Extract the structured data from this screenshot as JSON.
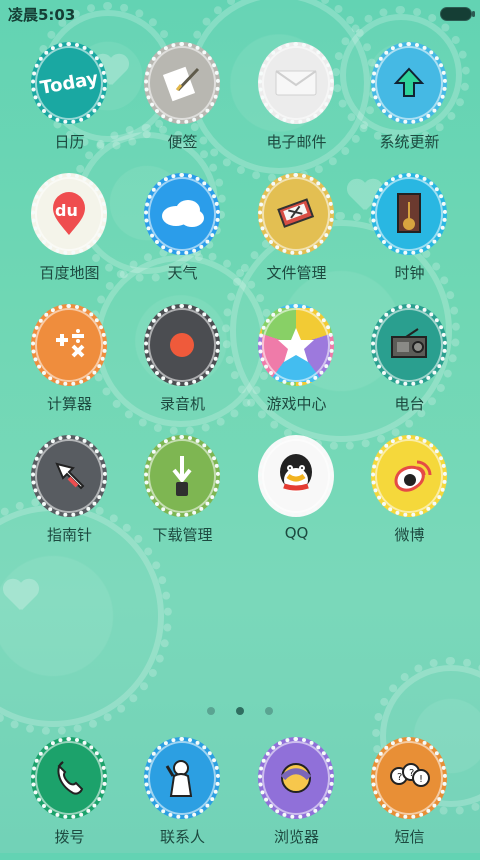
{
  "status_bar": {
    "time": "凌晨5:03"
  },
  "apps": [
    {
      "label": "日历",
      "icon": "calendar-icon",
      "color": "#1aa8a2",
      "text": "Today"
    },
    {
      "label": "便签",
      "icon": "notes-icon",
      "color": "#b8b7b1"
    },
    {
      "label": "电子邮件",
      "icon": "mail-icon",
      "color": "#ececec"
    },
    {
      "label": "系统更新",
      "icon": "system-update-icon",
      "color": "#45b9e4"
    },
    {
      "label": "百度地图",
      "icon": "baidu-map-icon",
      "color": "#f4f4ea",
      "text": "du"
    },
    {
      "label": "天气",
      "icon": "weather-icon",
      "color": "#2b9dea"
    },
    {
      "label": "文件管理",
      "icon": "file-manager-icon",
      "color": "#e3bf52"
    },
    {
      "label": "时钟",
      "icon": "clock-icon",
      "color": "#29b7e2"
    },
    {
      "label": "计算器",
      "icon": "calculator-icon",
      "color": "#ef8d3d"
    },
    {
      "label": "录音机",
      "icon": "recorder-icon",
      "color": "#4b4d51"
    },
    {
      "label": "游戏中心",
      "icon": "game-center-icon",
      "color": "#ffffff"
    },
    {
      "label": "电台",
      "icon": "radio-icon",
      "color": "#2a9f8f"
    },
    {
      "label": "指南针",
      "icon": "compass-icon",
      "color": "#585c61"
    },
    {
      "label": "下载管理",
      "icon": "download-manager-icon",
      "color": "#7eb652"
    },
    {
      "label": "QQ",
      "icon": "qq-icon",
      "color": "#f8f8f8"
    },
    {
      "label": "微博",
      "icon": "weibo-icon",
      "color": "#f5d83b"
    }
  ],
  "dock": [
    {
      "label": "拨号",
      "icon": "phone-icon",
      "color": "#1ca26b"
    },
    {
      "label": "联系人",
      "icon": "contacts-icon",
      "color": "#2c9fe2"
    },
    {
      "label": "浏览器",
      "icon": "browser-icon",
      "color": "#9070d9"
    },
    {
      "label": "短信",
      "icon": "messages-icon",
      "color": "#e88f36"
    }
  ],
  "page_indicator": {
    "total": 3,
    "active_index": 1
  }
}
